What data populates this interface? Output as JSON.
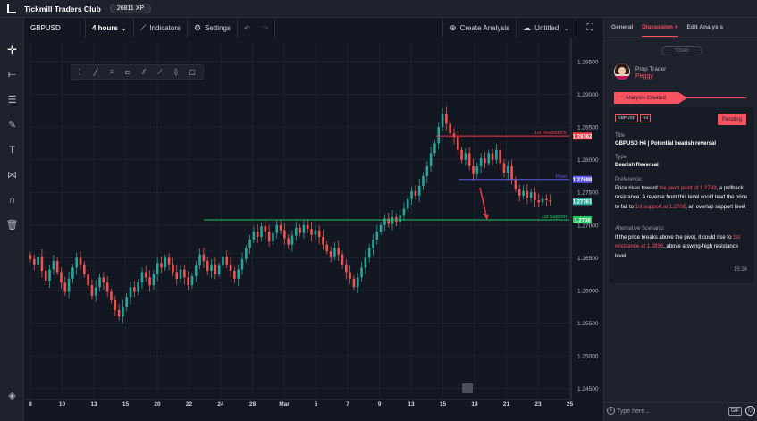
{
  "header": {
    "app_title": "Tickmill Traders Club",
    "xp_badge": "26811 XP"
  },
  "toolbar": {
    "symbol": "GBPUSD",
    "interval": "4 hours",
    "indicators": "Indicators",
    "settings": "Settings",
    "create_analysis": "Create Analysis",
    "layout_name": "Untitled"
  },
  "left_tools": [
    "crosshair-icon",
    "horizontal-line-icon",
    "fib-icon",
    "brush-icon",
    "text-icon",
    "pattern-icon",
    "magnet-icon",
    "trash-icon",
    "layers-icon"
  ],
  "drawing_toolbar": [
    "drag-icon",
    "pen-icon",
    "text-lines-icon",
    "fib-tool-icon",
    "channel-icon",
    "line-icon",
    "measure-icon",
    "rect-icon"
  ],
  "panel": {
    "tabs": [
      {
        "label": "General",
        "active": false
      },
      {
        "label": "Discussion",
        "active": true,
        "close": "×"
      },
      {
        "label": "Edit Analysis",
        "active": false
      }
    ],
    "today_label": "TODAY",
    "author_role": "Prop Trader",
    "author_name": "Peggy",
    "created_chip": "Analysis Created",
    "card": {
      "tag_symbol": "GBPUSD",
      "tag_interval": "H4",
      "status": "Pending",
      "title_label": "Title",
      "title_value": "GBPUSD H4 | Potential bearish reversal",
      "type_label": "Type",
      "type_value": "Bearish Reversal",
      "preference_label": "Preference:",
      "preference": {
        "p1": "Price rises toward ",
        "h1": "the pivot point of 1.2769",
        "p2": ", a pullback resistance. A reverse from this level could lead the price to fall to ",
        "h2": "1st support at 1.2708",
        "p3": ", an overlap support level"
      },
      "alt_label": "Alternative Scenario:",
      "alternative": {
        "p1": "If the price breaks above the pivot, it could rise to ",
        "h1": "1st resistance at 1.2836",
        "p2": ",  above a swing-high resistance level"
      },
      "time": "15:24"
    },
    "composer_placeholder": "Type here...",
    "gif_label": "GIF"
  },
  "colors": {
    "background": "#131722",
    "bull": "#26a69a",
    "bear": "#ef5350",
    "resistance": "#f23645",
    "pivot": "#5b5bf0",
    "support": "#22c55e",
    "accent": "#f7525f"
  },
  "chart_data": {
    "type": "candlestick",
    "symbol": "GBPUSD",
    "timeframe": "4 hours",
    "ylim": [
      1.244,
      1.298
    ],
    "y_ticks": [
      "1.29500",
      "1.29000",
      "1.28500",
      "1.28000",
      "1.27500",
      "1.27000",
      "1.26500",
      "1.26000",
      "1.25500",
      "1.25000",
      "1.24500"
    ],
    "x_ticks": [
      "8",
      "10",
      "13",
      "15",
      "20",
      "22",
      "24",
      "28",
      "Mar",
      "5",
      "7",
      "9",
      "13",
      "15",
      "19",
      "21",
      "23",
      "25"
    ],
    "levels": [
      {
        "name": "1st Resistance",
        "value": 1.28362,
        "label": "1.28362",
        "color": "#f23645"
      },
      {
        "name": "Pivot",
        "value": 1.27698,
        "label": "1.27698",
        "color": "#5b5bf0"
      },
      {
        "name": "1st Support",
        "value": 1.2708,
        "label": "1.2708",
        "color": "#22c55e"
      }
    ],
    "last_price": "1.27361",
    "closes": [
      1.2648,
      1.264,
      1.2652,
      1.263,
      1.2615,
      1.2632,
      1.2645,
      1.2628,
      1.2612,
      1.2598,
      1.2618,
      1.2635,
      1.265,
      1.264,
      1.2625,
      1.2608,
      1.2592,
      1.2605,
      1.262,
      1.2612,
      1.2598,
      1.2585,
      1.257,
      1.256,
      1.2575,
      1.259,
      1.2605,
      1.2598,
      1.2612,
      1.2628,
      1.262,
      1.2608,
      1.2625,
      1.2642,
      1.2635,
      1.265,
      1.264,
      1.2628,
      1.2618,
      1.2632,
      1.262,
      1.2608,
      1.2622,
      1.2638,
      1.2655,
      1.2645,
      1.263,
      1.264,
      1.2625,
      1.2638,
      1.2652,
      1.264,
      1.263,
      1.2618,
      1.2632,
      1.2648,
      1.2665,
      1.2678,
      1.269,
      1.2682,
      1.2698,
      1.269,
      1.2675,
      1.2688,
      1.27,
      1.2692,
      1.268,
      1.267,
      1.2684,
      1.2696,
      1.2688,
      1.27,
      1.2694,
      1.2685,
      1.2692,
      1.2682,
      1.267,
      1.266,
      1.2652,
      1.2665,
      1.2655,
      1.264,
      1.2628,
      1.2618,
      1.2605,
      1.262,
      1.2635,
      1.265,
      1.2665,
      1.2678,
      1.269,
      1.27,
      1.271,
      1.2702,
      1.2712,
      1.2705,
      1.2715,
      1.2725,
      1.274,
      1.2752,
      1.2745,
      1.276,
      1.2775,
      1.279,
      1.281,
      1.2825,
      1.285,
      1.287,
      1.2855,
      1.284,
      1.2835,
      1.2815,
      1.28,
      1.281,
      1.279,
      1.2778,
      1.279,
      1.2802,
      1.2795,
      1.281,
      1.28,
      1.2815,
      1.2795,
      1.278,
      1.279,
      1.277,
      1.2755,
      1.2745,
      1.2752,
      1.2742,
      1.275,
      1.2738,
      1.2735,
      1.274,
      1.2738,
      1.2736
    ]
  }
}
